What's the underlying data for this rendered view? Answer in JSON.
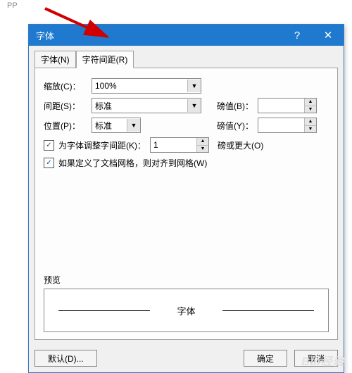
{
  "stray": "PP",
  "dialog": {
    "title": "字体",
    "help_icon": "?",
    "close_icon": "✕",
    "tabs": {
      "font": "字体(N)",
      "spacing": "字符间距(R)"
    },
    "fields": {
      "scale_label": "缩放(C)：",
      "scale_value": "100%",
      "spacing_label": "间距(S)：",
      "spacing_value": "标准",
      "spacing_val_label": "磅值(B)：",
      "spacing_val_value": "",
      "position_label": "位置(P)：",
      "position_value": "标准",
      "position_val_label": "磅值(Y)：",
      "position_val_value": "",
      "kerning_check": "为字体调整字间距(K)：",
      "kerning_value": "1",
      "kerning_suffix": "磅或更大(O)",
      "grid_check": "如果定义了文档网格，则对齐到网格(W)"
    },
    "preview_label": "预览",
    "preview_text": "字体",
    "buttons": {
      "default": "默认(D)...",
      "ok": "确定",
      "cancel": "取消"
    }
  },
  "watermark": "Bai经验"
}
